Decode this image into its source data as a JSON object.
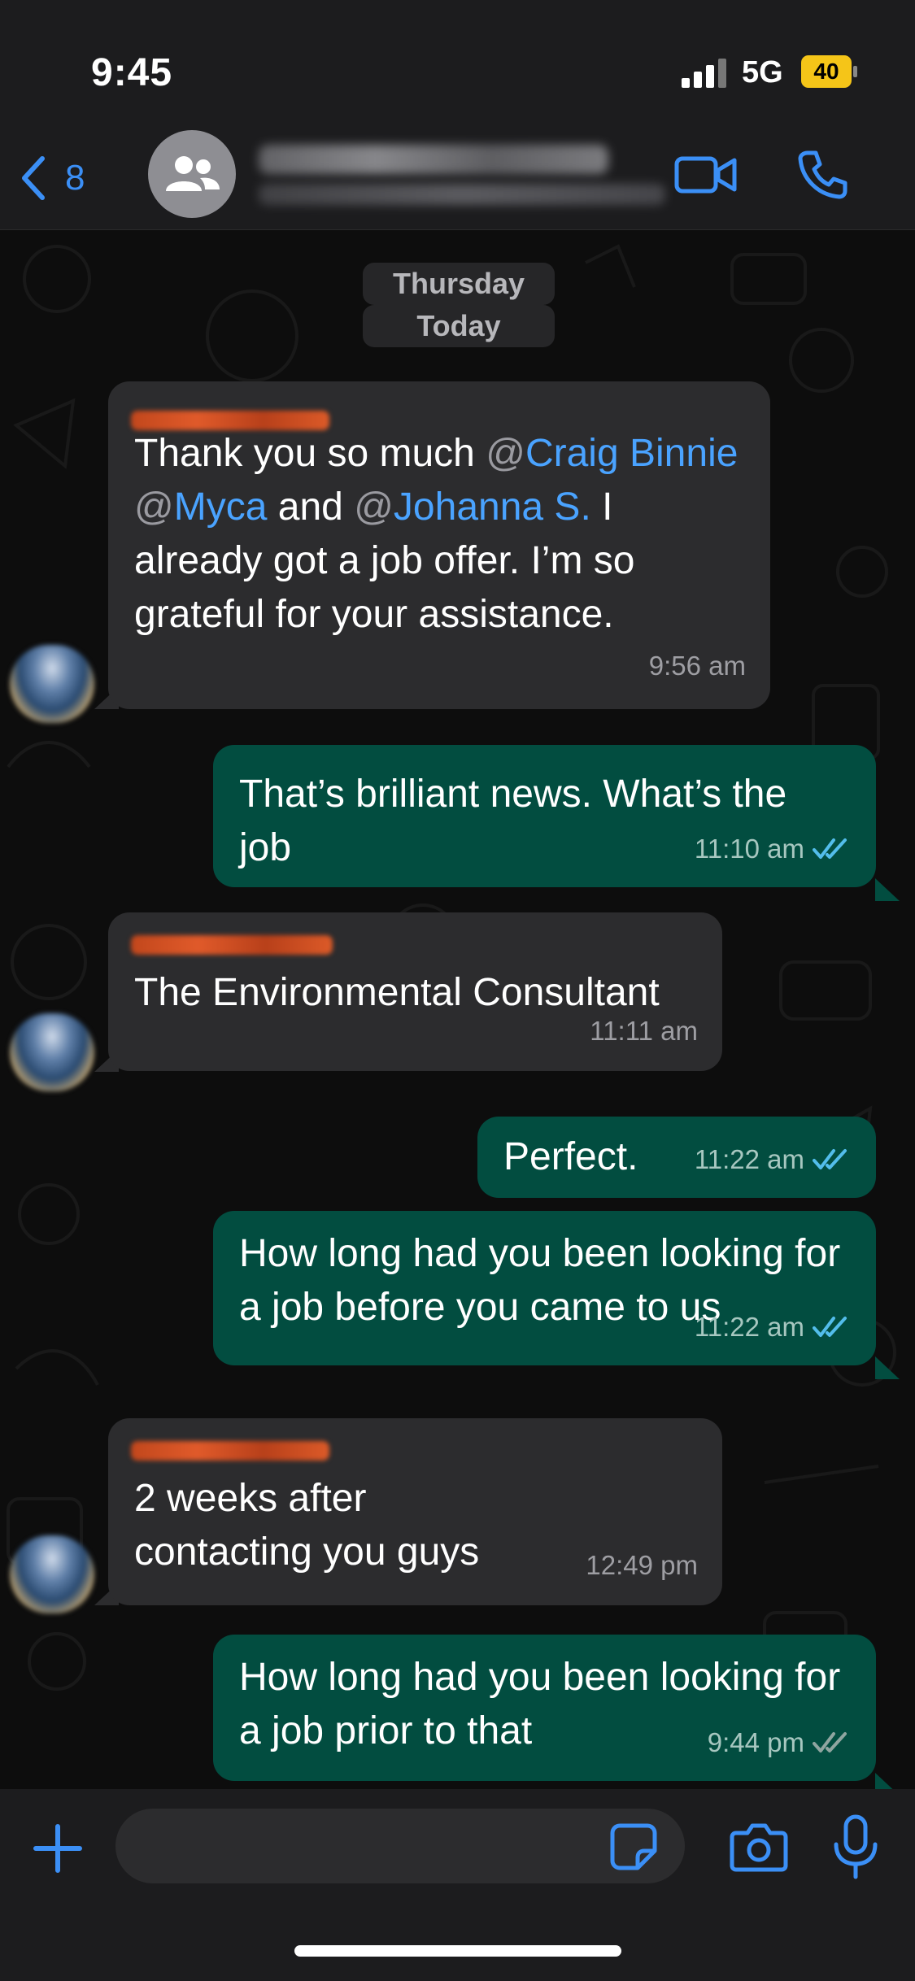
{
  "status_bar": {
    "time": "9:45",
    "network": "5G",
    "battery": "40"
  },
  "header": {
    "back_count": "8"
  },
  "date_chips": [
    "Thursday",
    "Today"
  ],
  "messages": [
    {
      "direction": "incoming",
      "segments": [
        {
          "text": "Thank you so much ",
          "style": "plain"
        },
        {
          "text": "@",
          "style": "at"
        },
        {
          "text": "Craig Binnie",
          "style": "mention"
        },
        {
          "text": " ",
          "style": "plain"
        },
        {
          "text": "@",
          "style": "at"
        },
        {
          "text": "Myca",
          "style": "mention"
        },
        {
          "text": " and ",
          "style": "plain"
        },
        {
          "text": "@",
          "style": "at"
        },
        {
          "text": "Johanna S.",
          "style": "mention"
        },
        {
          "text": " I already got a job offer. I’m so grateful for your assistance.",
          "style": "plain"
        }
      ],
      "time": "9:56 am"
    },
    {
      "direction": "outgoing",
      "text": "That’s brilliant news. What’s the job",
      "time": "11:10 am",
      "status": "read"
    },
    {
      "direction": "incoming",
      "text": "The Environmental Consultant",
      "time": "11:11 am"
    },
    {
      "direction": "outgoing",
      "text": "Perfect.",
      "time": "11:22 am",
      "status": "read"
    },
    {
      "direction": "outgoing",
      "text": "How long had you been looking for a job before you came to us",
      "time": "11:22 am",
      "status": "read"
    },
    {
      "direction": "incoming",
      "text": "2 weeks after contacting you guys",
      "time": "12:49 pm"
    },
    {
      "direction": "outgoing",
      "text": "How long had you been looking for a job prior to that",
      "time": "9:44 pm",
      "status": "delivered"
    }
  ],
  "composer": {
    "placeholder": ""
  },
  "colors": {
    "accent": "#3b8ff6",
    "outgoing_bubble": "#024d40",
    "incoming_bubble": "#2c2c2e",
    "mention": "#4aa3ff",
    "read_tick": "#53bdeb",
    "battery": "#f5c518"
  },
  "icons": [
    "chevron-left-icon",
    "group-icon",
    "video-call-icon",
    "phone-icon",
    "plus-icon",
    "sticker-icon",
    "camera-icon",
    "microphone-icon",
    "double-check-icon"
  ]
}
